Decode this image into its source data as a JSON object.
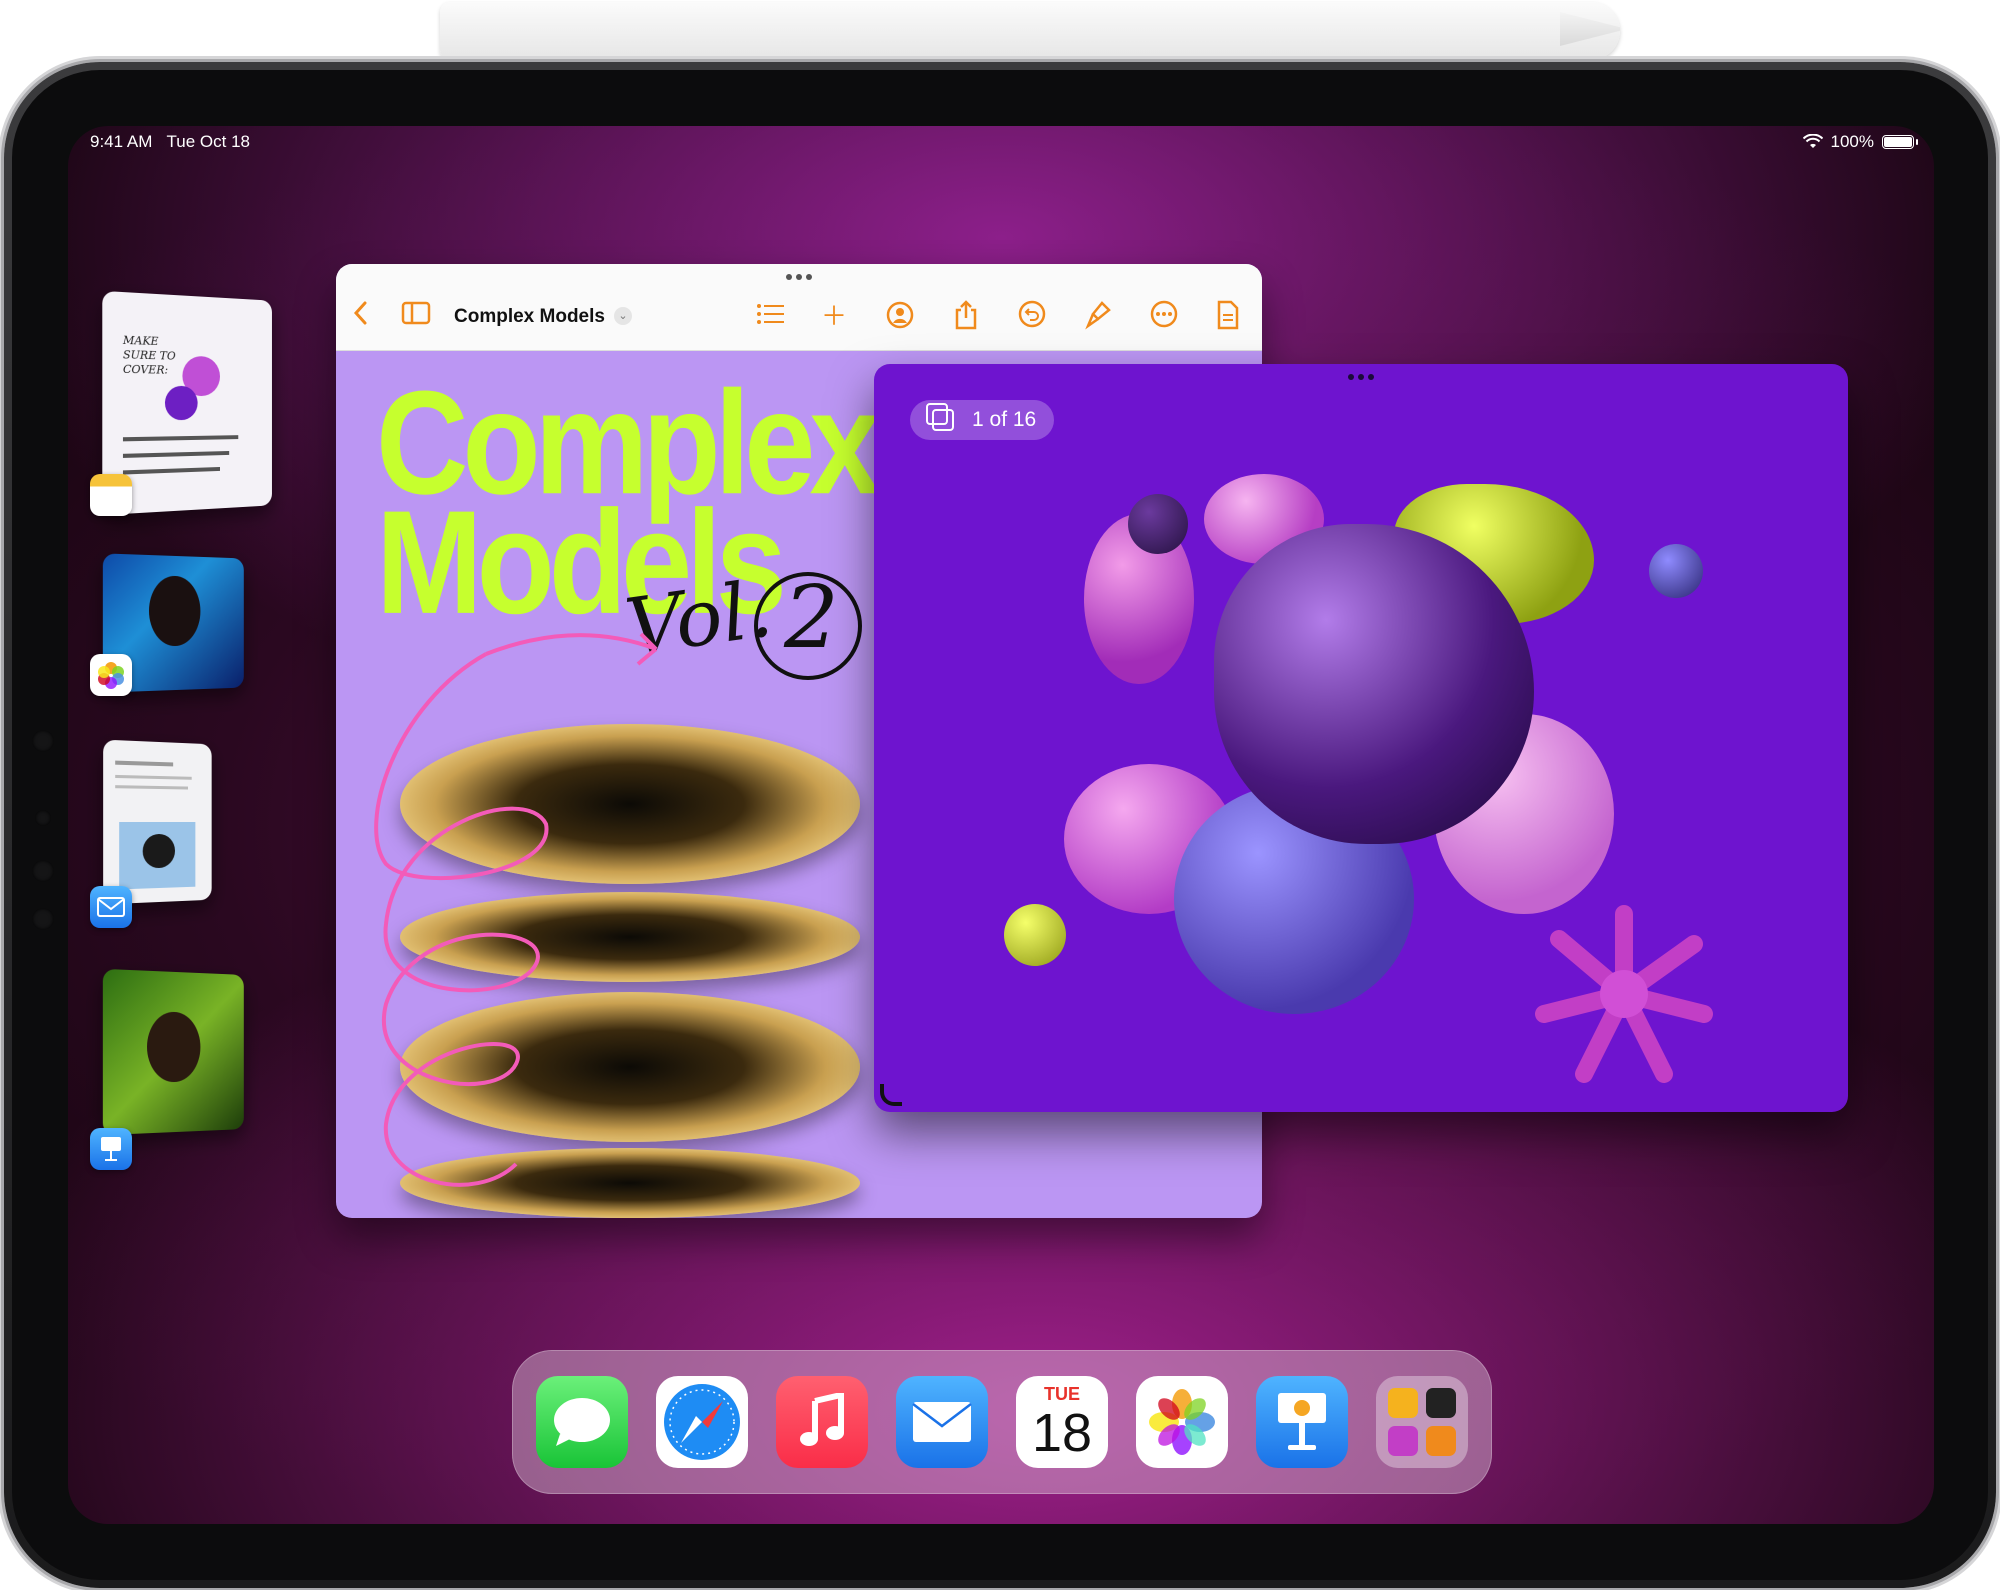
{
  "status_bar": {
    "time": "9:41 AM",
    "date": "Tue Oct 18",
    "battery": "100%"
  },
  "stage_strip": [
    {
      "app": "Notes",
      "icon": "notes-icon"
    },
    {
      "app": "Photos",
      "icon": "photos-icon"
    },
    {
      "app": "Mail",
      "icon": "mail-icon"
    },
    {
      "app": "Keynote",
      "icon": "keynote-icon"
    }
  ],
  "pages_window": {
    "title": "Complex Models",
    "document": {
      "title_line1": "Complex",
      "title_line2": "Models",
      "handwriting": "Vol.",
      "handwriting_number": "2"
    }
  },
  "keynote_window": {
    "slide_counter": "1 of 16"
  },
  "dock": {
    "apps": [
      "Messages",
      "Safari",
      "Music",
      "Mail",
      "Calendar",
      "Photos",
      "Keynote",
      "App Library"
    ],
    "calendar_day": "TUE",
    "calendar_date": "18"
  },
  "colors": {
    "accent_toolbar": "#f08a1c",
    "title_lime": "#c6ff2e",
    "page_lavender": "#bb96f3",
    "keynote_purple": "#6e14cf"
  }
}
